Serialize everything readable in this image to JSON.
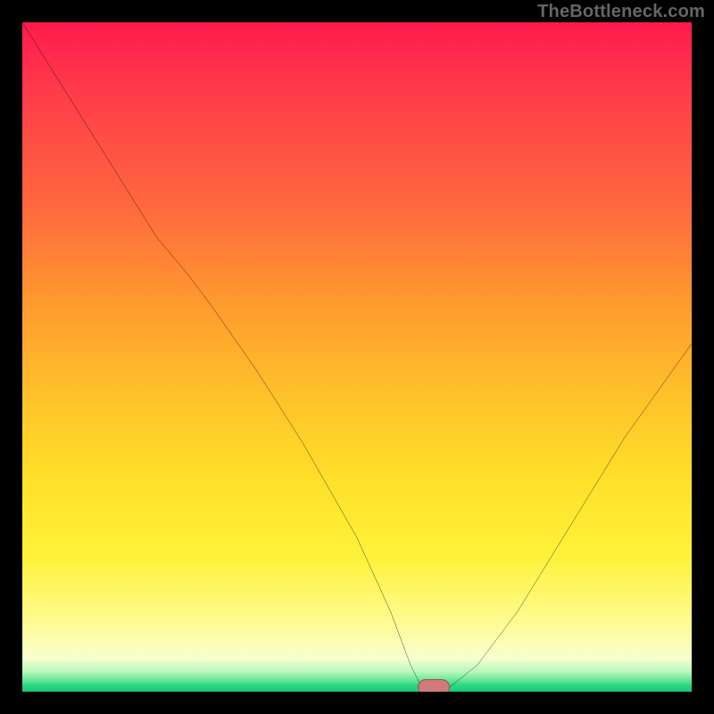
{
  "watermark": "TheBottleneck.com",
  "chart_data": {
    "type": "line",
    "title": "",
    "xlabel": "",
    "ylabel": "",
    "xlim": [
      0,
      100
    ],
    "ylim": [
      0,
      100
    ],
    "grid": false,
    "legend": false,
    "background": {
      "style": "vertical-gradient",
      "stops": [
        {
          "pct": 0,
          "color": "#ff1a4d"
        },
        {
          "pct": 28,
          "color": "#ff6a3e"
        },
        {
          "pct": 55,
          "color": "#ffbf2a"
        },
        {
          "pct": 80,
          "color": "#fff23a"
        },
        {
          "pct": 95,
          "color": "#f7ffd0"
        },
        {
          "pct": 100,
          "color": "#14c978"
        }
      ]
    },
    "series": [
      {
        "name": "bottleneck-curve",
        "color": "#000000",
        "x": [
          0,
          5,
          10,
          15,
          20,
          25,
          28,
          35,
          42,
          50,
          55,
          58,
          60,
          63,
          68,
          74,
          82,
          90,
          100
        ],
        "y": [
          100,
          92,
          84,
          76,
          68,
          62,
          58,
          48,
          37,
          23,
          12,
          4,
          0,
          0,
          4,
          12,
          25,
          38,
          52
        ]
      }
    ],
    "marker": {
      "name": "optimal-point",
      "x": 61.5,
      "y": 0.7,
      "color": "#d07b78"
    }
  }
}
